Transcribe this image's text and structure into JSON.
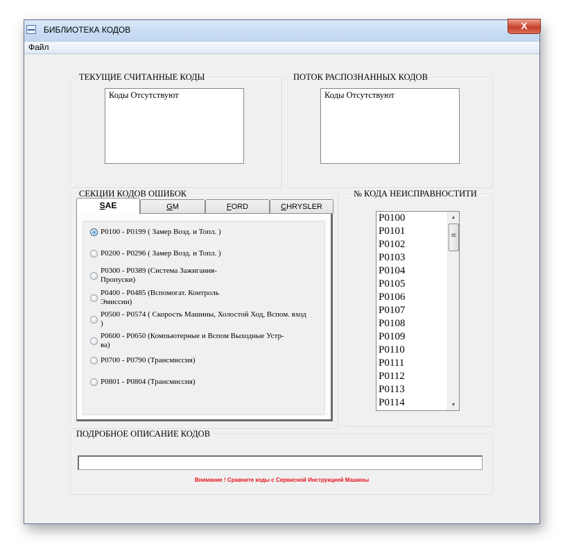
{
  "window": {
    "title": "БИБЛИОТЕКА КОДОВ",
    "close_label": "X"
  },
  "menu": {
    "items": [
      {
        "label": "Файл"
      }
    ]
  },
  "current_codes": {
    "title": "ТЕКУЩИЕ СЧИТАННЫЕ КОДЫ",
    "content": "Коды Отсутствуют"
  },
  "stream_codes": {
    "title": "ПОТОК РАСПОЗНАННЫХ КОДОВ",
    "content": "Коды Отсутствуют"
  },
  "sections": {
    "title": "СЕКЦИИ КОДОВ ОШИБОК",
    "tabs": [
      {
        "accel": "S",
        "rest": "AE",
        "active": true
      },
      {
        "accel": "G",
        "rest": "M",
        "active": false
      },
      {
        "accel": "F",
        "rest": "ORD",
        "active": false
      },
      {
        "accel": "C",
        "rest": "HRYSLER",
        "active": false
      }
    ],
    "options": [
      {
        "label": "P0100 - P0199 ( Замер Возд. и Топл. )",
        "checked": true
      },
      {
        "label": "P0200 - P0296 ( Замер Возд. и Топл. )",
        "checked": false
      },
      {
        "label": "P0300 - P0389 (Система Зажигания-Пропуски)",
        "checked": false
      },
      {
        "label": "P0400 - P0485 (Вспомогат. Контроль Эмиссии)",
        "checked": false
      },
      {
        "label": "P0500 - P0574 ( Скорость Машины, Холостой Ход, Вспом. вход )",
        "checked": false
      },
      {
        "label": "P0600 - P0650 (Компьютерные и Вспом Выходные Устр-ва)",
        "checked": false
      },
      {
        "label": "P0700 - P0790 (Трансмиссия)",
        "checked": false
      },
      {
        "label": "P0801 - P0804 (Трансмиссия)",
        "checked": false
      }
    ]
  },
  "fault_codes": {
    "title": "№ КОДА НЕИСПРАВНОСТИТИ",
    "items": [
      "P0100",
      "P0101",
      "P0102",
      "P0103",
      "P0104",
      "P0105",
      "P0106",
      "P0107",
      "P0108",
      "P0109",
      "P0110",
      "P0111",
      "P0112",
      "P0113",
      "P0114"
    ],
    "scroll_up": "▲",
    "scroll_down": "▼"
  },
  "description": {
    "title": "ПОДРОБНОЕ ОПИСАНИЕ КОДОВ",
    "value": "",
    "warning": "Внимание ! Сравните коды с Сервисной Инструкцией Машины",
    "warning_color": "#e8101c"
  }
}
